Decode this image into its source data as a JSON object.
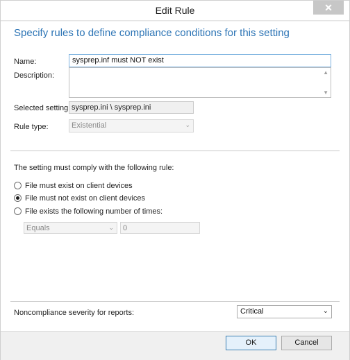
{
  "window": {
    "title": "Edit Rule",
    "close_glyph": "✕"
  },
  "header": {
    "text": "Specify rules to define compliance conditions for this setting"
  },
  "form": {
    "name_label": "Name:",
    "name_value": "sysprep.inf must NOT exist",
    "description_label": "Description:",
    "description_value": "",
    "selected_setting_label": "Selected setting:",
    "selected_setting_value": "sysprep.ini \\ sysprep.ini",
    "rule_type_label": "Rule type:",
    "rule_type_value": "Existential"
  },
  "rule": {
    "heading": "The setting must comply with the following rule:",
    "options": [
      {
        "label": "File must exist on client devices",
        "selected": false
      },
      {
        "label": "File must not exist on client devices",
        "selected": true
      },
      {
        "label": "File exists the following number of times:",
        "selected": false
      }
    ],
    "operator_value": "Equals",
    "count_value": "0"
  },
  "severity": {
    "label": "Noncompliance severity for reports:",
    "value": "Critical"
  },
  "buttons": {
    "ok": "OK",
    "cancel": "Cancel"
  },
  "icons": {
    "chevron": "⌄",
    "scroll_up": "▲",
    "scroll_down": "▼"
  }
}
